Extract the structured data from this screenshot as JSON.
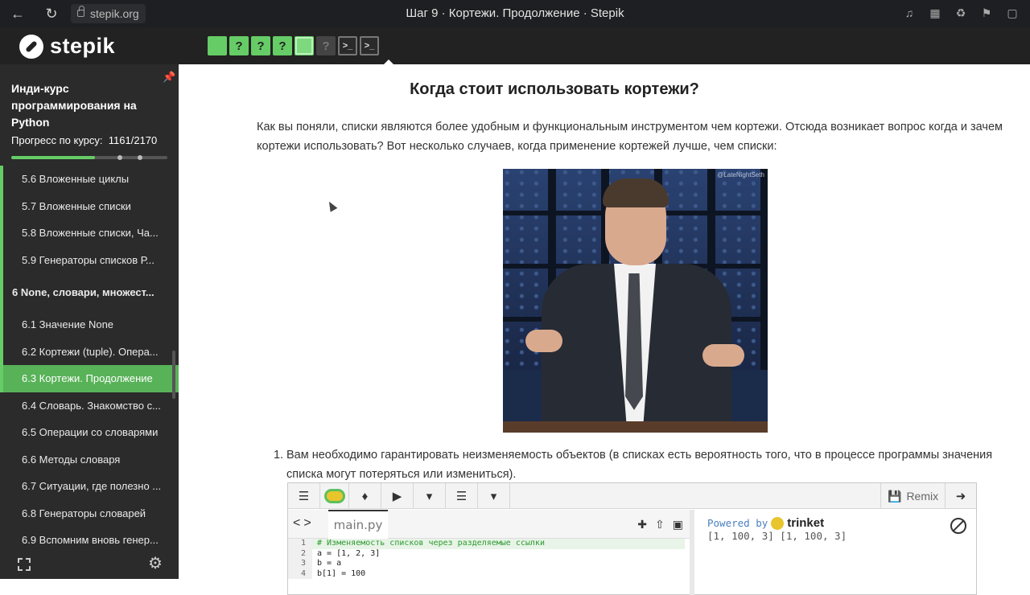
{
  "browser": {
    "url": "stepik.org",
    "tab_title": "Шаг 9 · Кортежи. Продолжение · Stepik"
  },
  "header": {
    "brand": "stepik",
    "steps": [
      {
        "type": "filled",
        "glyph": ""
      },
      {
        "type": "quiz",
        "glyph": "?"
      },
      {
        "type": "quiz",
        "glyph": "?"
      },
      {
        "type": "quiz",
        "glyph": "?"
      },
      {
        "type": "code",
        "glyph": ">_"
      },
      {
        "type": "code",
        "glyph": ">_"
      },
      {
        "type": "code",
        "glyph": ">_"
      },
      {
        "type": "code",
        "glyph": ">_"
      },
      {
        "type": "active",
        "glyph": ""
      },
      {
        "type": "quiz-gray",
        "glyph": "?"
      },
      {
        "type": "code-gray",
        "glyph": ">_"
      },
      {
        "type": "code-gray",
        "glyph": ">_"
      }
    ]
  },
  "sidebar": {
    "course_title": "Инди-курс программирования на Python",
    "progress_label": "Прогресс по курсу:",
    "progress_value": "1161/2170",
    "progress_fraction": 0.535,
    "lessons": [
      {
        "label": "5.6  Вложенные циклы",
        "kind": "lesson",
        "done": true
      },
      {
        "label": "5.7  Вложенные списки",
        "kind": "lesson",
        "done": true
      },
      {
        "label": "5.8  Вложенные списки, Ча...",
        "kind": "lesson",
        "done": true
      },
      {
        "label": "5.9  Генераторы списков Р...",
        "kind": "lesson",
        "done": true
      },
      {
        "label": "6  None, словари, множест...",
        "kind": "module",
        "done": true
      },
      {
        "label": "6.1  Значение None",
        "kind": "lesson",
        "done": true
      },
      {
        "label": "6.2  Кортежи (tuple). Опера...",
        "kind": "lesson",
        "done": true
      },
      {
        "label": "6.3  Кортежи. Продолжение",
        "kind": "lesson",
        "done": true,
        "active": true
      },
      {
        "label": "6.4  Словарь. Знакомство с...",
        "kind": "lesson",
        "done": false
      },
      {
        "label": "6.5  Операции со словарями",
        "kind": "lesson",
        "done": false
      },
      {
        "label": "6.6  Методы словаря",
        "kind": "lesson",
        "done": false
      },
      {
        "label": "6.7  Ситуации, где полезно ...",
        "kind": "lesson",
        "done": false
      },
      {
        "label": "6.8  Генераторы словарей",
        "kind": "lesson",
        "done": false
      },
      {
        "label": "6.9  Вспомним вновь генер...",
        "kind": "lesson",
        "done": false
      }
    ]
  },
  "main": {
    "heading": "Когда стоит использовать кортежи?",
    "intro": "Как вы поняли, списки являются более удобным и функциональным инструментом чем кортежи. Отсюда возникает вопрос когда и зачем кортежи использовать? Вот несколько случаев, когда применение кортежей лучше, чем списки:",
    "image_watermark": "@LateNightSeth",
    "list_number": "1.",
    "list_item": "Вам необходимо гарантировать неизменяемость объектов (в списках есть вероятность того, что в процессе программы значения списка могут потеряться или измениться)."
  },
  "trinket": {
    "remix_label": "Remix",
    "file_tab": "main.py",
    "code_lines": [
      {
        "n": "1",
        "text": "# Изменяемость списков через разделяемые ссылки",
        "comment": true
      },
      {
        "n": "2",
        "text": "a = [1, 2, 3]",
        "comment": false
      },
      {
        "n": "3",
        "text": "b = a",
        "comment": false
      },
      {
        "n": "4",
        "text": "b[1] = 100",
        "comment": false
      }
    ],
    "powered_by": "Powered by",
    "brand": "trinket",
    "output": "[1, 100, 3] [1, 100, 3]"
  }
}
